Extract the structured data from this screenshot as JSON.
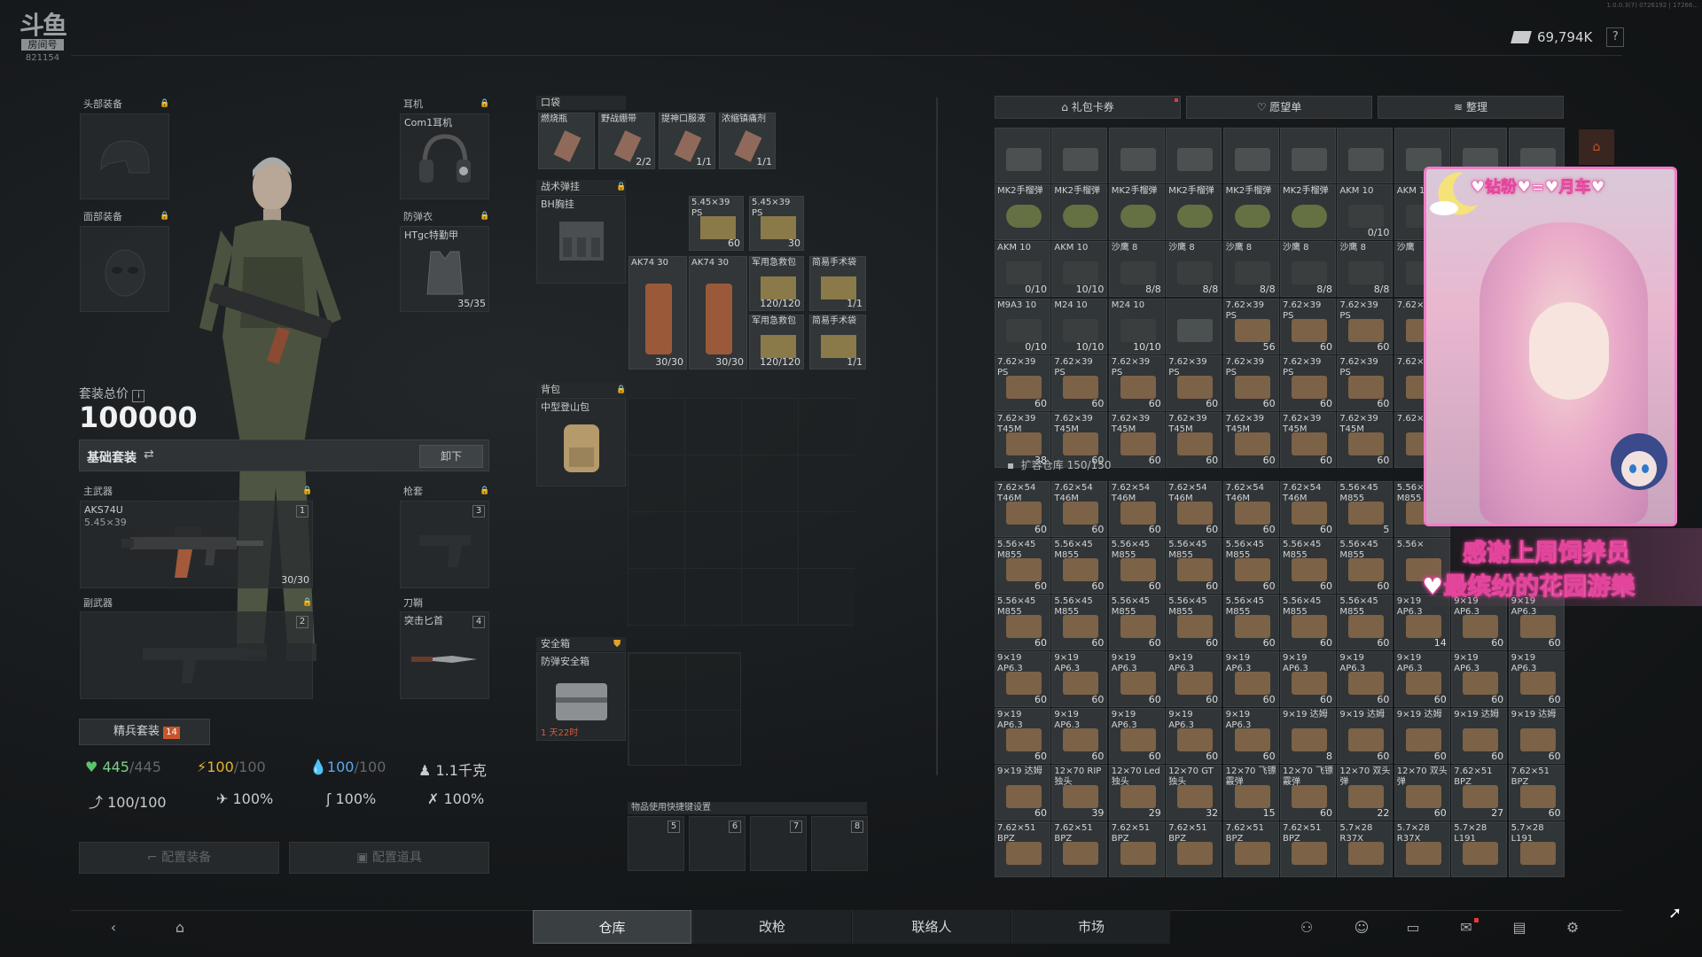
{
  "logo": {
    "line1": "斗鱼",
    "line2": "房间号",
    "room": "821154"
  },
  "version": "1.0.0.3(7) 0726192 | 17266...",
  "money": {
    "amount": "69,794K",
    "help": "?"
  },
  "equip": {
    "head": {
      "title": "头部装备"
    },
    "face": {
      "title": "面部装备"
    },
    "headset": {
      "title": "耳机",
      "name": "Com1耳机"
    },
    "armor": {
      "title": "防弹衣",
      "name": "HTgc特勤甲",
      "count": "35/35"
    },
    "primary": {
      "title": "主武器",
      "name": "AKS74U",
      "sub": "5.45×39",
      "count": "30/30",
      "slot": "1"
    },
    "secondary": {
      "title": "副武器",
      "slot": "2"
    },
    "holster": {
      "title": "枪套",
      "slot": "3"
    },
    "melee": {
      "title": "刀鞘",
      "name": "突击匕首",
      "slot": "4"
    }
  },
  "kit": {
    "label": "套装总价",
    "value": "100000",
    "name": "基础套装",
    "unequip": "卸下",
    "elite": "精兵套装",
    "elite_badge": "14"
  },
  "stats": {
    "hp": "445",
    "hp_max": "/445",
    "energy": "100",
    "energy_max": "/100",
    "water": "100",
    "water_max": "/100",
    "weight": "1.1千克",
    "stamina": "100/100",
    "s2": "100%",
    "s3": "100%",
    "s4": "100%"
  },
  "config_buttons": {
    "equip": "配置装备",
    "items": "配置道具"
  },
  "pockets": {
    "title": "口袋",
    "items": [
      {
        "name": "燃烧瓶",
        "count": ""
      },
      {
        "name": "野战绷带",
        "count": "2/2"
      },
      {
        "name": "提神口服液",
        "count": "1/1"
      },
      {
        "name": "浓缩镇痛剂",
        "count": "1/1"
      }
    ]
  },
  "rig": {
    "title": "战术弹挂",
    "name": "BH胸挂",
    "items": [
      {
        "name": "5.45×39\nPS",
        "count": "60"
      },
      {
        "name": "5.45×39\nPS",
        "count": "30"
      },
      {
        "name": "AK74 30",
        "count": "30/30"
      },
      {
        "name": "AK74 30",
        "count": "30/30"
      },
      {
        "name": "军用急救包",
        "count": "120/120"
      },
      {
        "name": "简易手术袋",
        "count": "1/1"
      },
      {
        "name": "军用急救包",
        "count": "120/120"
      },
      {
        "name": "简易手术袋",
        "count": "1/1"
      }
    ]
  },
  "backpack": {
    "title": "背包",
    "name": "中型登山包"
  },
  "secure": {
    "title": "安全箱",
    "name": "防弹安全箱",
    "timer": "1 天22时"
  },
  "quickbar": {
    "title": "物品使用快捷键设置",
    "slots": [
      "5",
      "6",
      "7",
      "8"
    ]
  },
  "stash_tabs": {
    "gift": "礼包卡券",
    "wish": "愿望单",
    "sort": "整理"
  },
  "stash_rows": [
    [
      {
        "n": "",
        "c": ""
      },
      {
        "n": "",
        "c": ""
      },
      {
        "n": "",
        "c": ""
      },
      {
        "n": "",
        "c": ""
      },
      {
        "n": "",
        "c": ""
      },
      {
        "n": "",
        "c": ""
      },
      {
        "n": "",
        "c": ""
      },
      {
        "n": "",
        "c": ""
      },
      {
        "n": "",
        "c": ""
      },
      {
        "n": "",
        "c": ""
      }
    ],
    [
      {
        "n": "MK2手榴弹",
        "c": ""
      },
      {
        "n": "MK2手榴弹",
        "c": ""
      },
      {
        "n": "MK2手榴弹",
        "c": ""
      },
      {
        "n": "MK2手榴弹",
        "c": ""
      },
      {
        "n": "MK2手榴弹",
        "c": ""
      },
      {
        "n": "MK2手榴弹",
        "c": ""
      },
      {
        "n": "AKM 10",
        "c": "0/10"
      },
      {
        "n": "AKM 10",
        "c": ""
      }
    ],
    [
      {
        "n": "AKM 10",
        "c": "0/10"
      },
      {
        "n": "AKM 10",
        "c": "10/10"
      },
      {
        "n": "沙鹰 8",
        "c": "8/8"
      },
      {
        "n": "沙鹰 8",
        "c": "8/8"
      },
      {
        "n": "沙鹰 8",
        "c": "8/8"
      },
      {
        "n": "沙鹰 8",
        "c": "8/8"
      },
      {
        "n": "沙鹰 8",
        "c": "8/8"
      },
      {
        "n": "沙鹰",
        "c": ""
      }
    ],
    [
      {
        "n": "M9A3 10",
        "c": "0/10"
      },
      {
        "n": "M24 10",
        "c": "10/10"
      },
      {
        "n": "M24 10",
        "c": "10/10"
      },
      {
        "n": "",
        "c": ""
      },
      {
        "n": "7.62×39\nPS",
        "c": "56"
      },
      {
        "n": "7.62×39\nPS",
        "c": "60"
      },
      {
        "n": "7.62×39\nPS",
        "c": "60"
      },
      {
        "n": "7.62×",
        "c": ""
      }
    ],
    [
      {
        "n": "7.62×39\nPS",
        "c": "60"
      },
      {
        "n": "7.62×39\nPS",
        "c": "60"
      },
      {
        "n": "7.62×39\nPS",
        "c": "60"
      },
      {
        "n": "7.62×39\nPS",
        "c": "60"
      },
      {
        "n": "7.62×39\nPS",
        "c": "60"
      },
      {
        "n": "7.62×39\nPS",
        "c": "60"
      },
      {
        "n": "7.62×39\nPS",
        "c": "60"
      },
      {
        "n": "7.62×",
        "c": ""
      }
    ],
    [
      {
        "n": "7.62×39\nT45M",
        "c": "38"
      },
      {
        "n": "7.62×39\nT45M",
        "c": "60"
      },
      {
        "n": "7.62×39\nT45M",
        "c": "60"
      },
      {
        "n": "7.62×39\nT45M",
        "c": "60"
      },
      {
        "n": "7.62×39\nT45M",
        "c": "60"
      },
      {
        "n": "7.62×39\nT45M",
        "c": "60"
      },
      {
        "n": "7.62×39\nT45M",
        "c": "60"
      },
      {
        "n": "7.62×",
        "c": ""
      }
    ]
  ],
  "ext_stash": {
    "title": "扩容仓库",
    "count": "150/150"
  },
  "ext_rows": [
    [
      {
        "n": "7.62×54\nT46M",
        "c": "60"
      },
      {
        "n": "7.62×54\nT46M",
        "c": "60"
      },
      {
        "n": "7.62×54\nT46M",
        "c": "60"
      },
      {
        "n": "7.62×54\nT46M",
        "c": "60"
      },
      {
        "n": "7.62×54\nT46M",
        "c": "60"
      },
      {
        "n": "7.62×54\nT46M",
        "c": "60"
      },
      {
        "n": "5.56×45\nM855",
        "c": "5"
      },
      {
        "n": "5.56×\nM855",
        "c": ""
      }
    ],
    [
      {
        "n": "5.56×45\nM855",
        "c": "60"
      },
      {
        "n": "5.56×45\nM855",
        "c": "60"
      },
      {
        "n": "5.56×45\nM855",
        "c": "60"
      },
      {
        "n": "5.56×45\nM855",
        "c": "60"
      },
      {
        "n": "5.56×45\nM855",
        "c": "60"
      },
      {
        "n": "5.56×45\nM855",
        "c": "60"
      },
      {
        "n": "5.56×45\nM855",
        "c": "60"
      },
      {
        "n": "5.56×",
        "c": ""
      }
    ],
    [
      {
        "n": "5.56×45\nM855",
        "c": "60"
      },
      {
        "n": "5.56×45\nM855",
        "c": "60"
      },
      {
        "n": "5.56×45\nM855",
        "c": "60"
      },
      {
        "n": "5.56×45\nM855",
        "c": "60"
      },
      {
        "n": "5.56×45\nM855",
        "c": "60"
      },
      {
        "n": "5.56×45\nM855",
        "c": "60"
      },
      {
        "n": "5.56×45\nM855",
        "c": "60"
      },
      {
        "n": "9×19\nAP6.3",
        "c": "14"
      },
      {
        "n": "9×19\nAP6.3",
        "c": "60"
      },
      {
        "n": "9×19\nAP6.3",
        "c": "60"
      }
    ],
    [
      {
        "n": "9×19\nAP6.3",
        "c": "60"
      },
      {
        "n": "9×19\nAP6.3",
        "c": "60"
      },
      {
        "n": "9×19\nAP6.3",
        "c": "60"
      },
      {
        "n": "9×19\nAP6.3",
        "c": "60"
      },
      {
        "n": "9×19\nAP6.3",
        "c": "60"
      },
      {
        "n": "9×19\nAP6.3",
        "c": "60"
      },
      {
        "n": "9×19\nAP6.3",
        "c": "60"
      },
      {
        "n": "9×19\nAP6.3",
        "c": "60"
      },
      {
        "n": "9×19\nAP6.3",
        "c": "60"
      },
      {
        "n": "9×19\nAP6.3",
        "c": "60"
      }
    ],
    [
      {
        "n": "9×19\nAP6.3",
        "c": "60"
      },
      {
        "n": "9×19\nAP6.3",
        "c": "60"
      },
      {
        "n": "9×19\nAP6.3",
        "c": "60"
      },
      {
        "n": "9×19\nAP6.3",
        "c": "60"
      },
      {
        "n": "9×19\nAP6.3",
        "c": "60"
      },
      {
        "n": "9×19 达姆",
        "c": "8"
      },
      {
        "n": "9×19 达姆",
        "c": "60"
      },
      {
        "n": "9×19 达姆",
        "c": "60"
      },
      {
        "n": "9×19 达姆",
        "c": "60"
      },
      {
        "n": "9×19 达姆",
        "c": "60"
      }
    ],
    [
      {
        "n": "9×19 达姆",
        "c": "60"
      },
      {
        "n": "12×70 RIP\n独头",
        "c": "39"
      },
      {
        "n": "12×70 Led\n独头",
        "c": "29"
      },
      {
        "n": "12×70 GT\n独头",
        "c": "32"
      },
      {
        "n": "12×70 飞镖\n霰弹",
        "c": "15"
      },
      {
        "n": "12×70 飞镖\n霰弹",
        "c": "60"
      },
      {
        "n": "12×70 双头\n弹",
        "c": "22"
      },
      {
        "n": "12×70 双头\n弹",
        "c": "60"
      },
      {
        "n": "7.62×51\nBPZ",
        "c": "27"
      },
      {
        "n": "7.62×51\nBPZ",
        "c": "60"
      }
    ],
    [
      {
        "n": "7.62×51\nBPZ",
        "c": ""
      },
      {
        "n": "7.62×51\nBPZ",
        "c": ""
      },
      {
        "n": "7.62×51\nBPZ",
        "c": ""
      },
      {
        "n": "7.62×51\nBPZ",
        "c": ""
      },
      {
        "n": "7.62×51\nBPZ",
        "c": ""
      },
      {
        "n": "7.62×51\nBPZ",
        "c": ""
      },
      {
        "n": "5.7×28\nR37X",
        "c": ""
      },
      {
        "n": "5.7×28\nR37X",
        "c": ""
      },
      {
        "n": "5.7×28\nL191",
        "c": ""
      },
      {
        "n": "5.7×28\nL191",
        "c": ""
      }
    ]
  ],
  "stream": {
    "title": "♥钻粉♥=♥月车♥",
    "banner1": "感谢上周饲养员",
    "banner2": "♥最缤纷的花园游樂"
  },
  "nav": {
    "tabs": [
      "仓库",
      "改枪",
      "联络人",
      "市场"
    ]
  }
}
